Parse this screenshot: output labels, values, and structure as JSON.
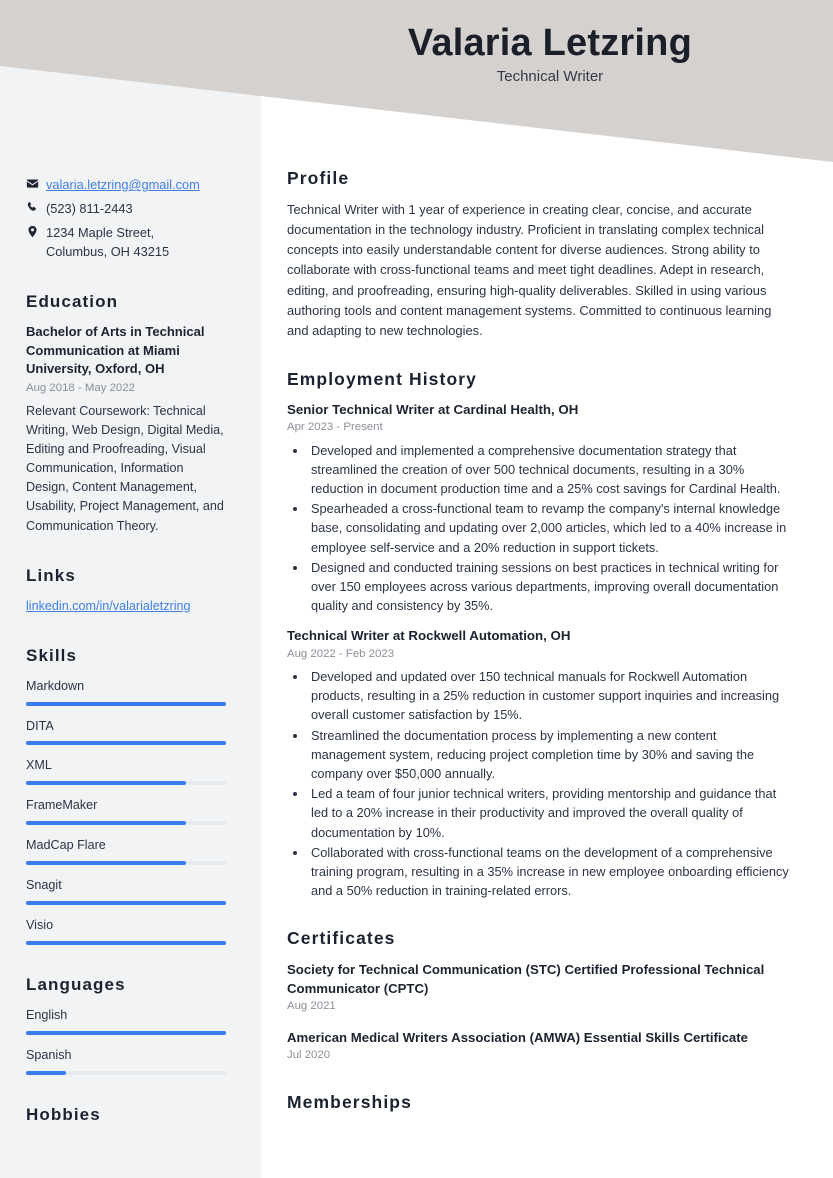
{
  "header": {
    "name": "Valaria Letzring",
    "title": "Technical Writer",
    "band_color": "#d4d1ce"
  },
  "theme": {
    "sidebar_bg": "#f2f3f5",
    "accent_blue": "#3b7bf0",
    "link_blue": "#3f7fe0",
    "heading_color": "#1b2330",
    "muted_color": "#8b8f98"
  },
  "sidebar": {
    "contact": [
      {
        "icon": "envelope-icon",
        "text": "valaria.letzring@gmail.com",
        "is_link": true
      },
      {
        "icon": "phone-icon",
        "text": "(523) 811-2443",
        "is_link": false
      },
      {
        "icon": "location-pin-icon",
        "text": "1234 Maple Street,\nColumbus, OH 43215",
        "is_link": false
      }
    ],
    "education": {
      "heading": "Education",
      "entries": [
        {
          "title": "Bachelor of Arts in Technical Communication at Miami University, Oxford, OH",
          "date": "Aug 2018 - May 2022",
          "description": "Relevant Coursework: Technical Writing, Web Design, Digital Media, Editing and Proofreading, Visual Communication, Information Design, Content Management, Usability, Project Management, and Communication Theory."
        }
      ]
    },
    "links": {
      "heading": "Links",
      "items": [
        {
          "label": "linkedin.com/in/valarialetzring"
        }
      ]
    },
    "skills": {
      "heading": "Skills",
      "items": [
        {
          "label": "Markdown",
          "level": 100
        },
        {
          "label": "DITA",
          "level": 100
        },
        {
          "label": "XML",
          "level": 80
        },
        {
          "label": "FrameMaker",
          "level": 80
        },
        {
          "label": "MadCap Flare",
          "level": 80
        },
        {
          "label": "Snagit",
          "level": 100
        },
        {
          "label": "Visio",
          "level": 100
        }
      ]
    },
    "languages": {
      "heading": "Languages",
      "items": [
        {
          "label": "English",
          "level": 100
        },
        {
          "label": "Spanish",
          "level": 20
        }
      ]
    },
    "hobbies": {
      "heading": "Hobbies"
    }
  },
  "main": {
    "profile": {
      "heading": "Profile",
      "text": "Technical Writer with 1 year of experience in creating clear, concise, and accurate documentation in the technology industry. Proficient in translating complex technical concepts into easily understandable content for diverse audiences. Strong ability to collaborate with cross-functional teams and meet tight deadlines. Adept in research, editing, and proofreading, ensuring high-quality deliverables. Skilled in using various authoring tools and content management systems. Committed to continuous learning and adapting to new technologies."
    },
    "employment": {
      "heading": "Employment History",
      "jobs": [
        {
          "title": "Senior Technical Writer at Cardinal Health, OH",
          "date": "Apr 2023 - Present",
          "bullets": [
            "Developed and implemented a comprehensive documentation strategy that streamlined the creation of over 500 technical documents, resulting in a 30% reduction in document production time and a 25% cost savings for Cardinal Health.",
            "Spearheaded a cross-functional team to revamp the company's internal knowledge base, consolidating and updating over 2,000 articles, which led to a 40% increase in employee self-service and a 20% reduction in support tickets.",
            "Designed and conducted training sessions on best practices in technical writing for over 150 employees across various departments, improving overall documentation quality and consistency by 35%."
          ]
        },
        {
          "title": "Technical Writer at Rockwell Automation, OH",
          "date": "Aug 2022 - Feb 2023",
          "bullets": [
            "Developed and updated over 150 technical manuals for Rockwell Automation products, resulting in a 25% reduction in customer support inquiries and increasing overall customer satisfaction by 15%.",
            "Streamlined the documentation process by implementing a new content management system, reducing project completion time by 30% and saving the company over $50,000 annually.",
            "Led a team of four junior technical writers, providing mentorship and guidance that led to a 20% increase in their productivity and improved the overall quality of documentation by 10%.",
            "Collaborated with cross-functional teams on the development of a comprehensive training program, resulting in a 35% increase in new employee onboarding efficiency and a 50% reduction in training-related errors."
          ]
        }
      ]
    },
    "certificates": {
      "heading": "Certificates",
      "items": [
        {
          "title": "Society for Technical Communication (STC) Certified Professional Technical Communicator (CPTC)",
          "date": "Aug 2021"
        },
        {
          "title": "American Medical Writers Association (AMWA) Essential Skills Certificate",
          "date": "Jul 2020"
        }
      ]
    },
    "memberships": {
      "heading": "Memberships"
    }
  }
}
